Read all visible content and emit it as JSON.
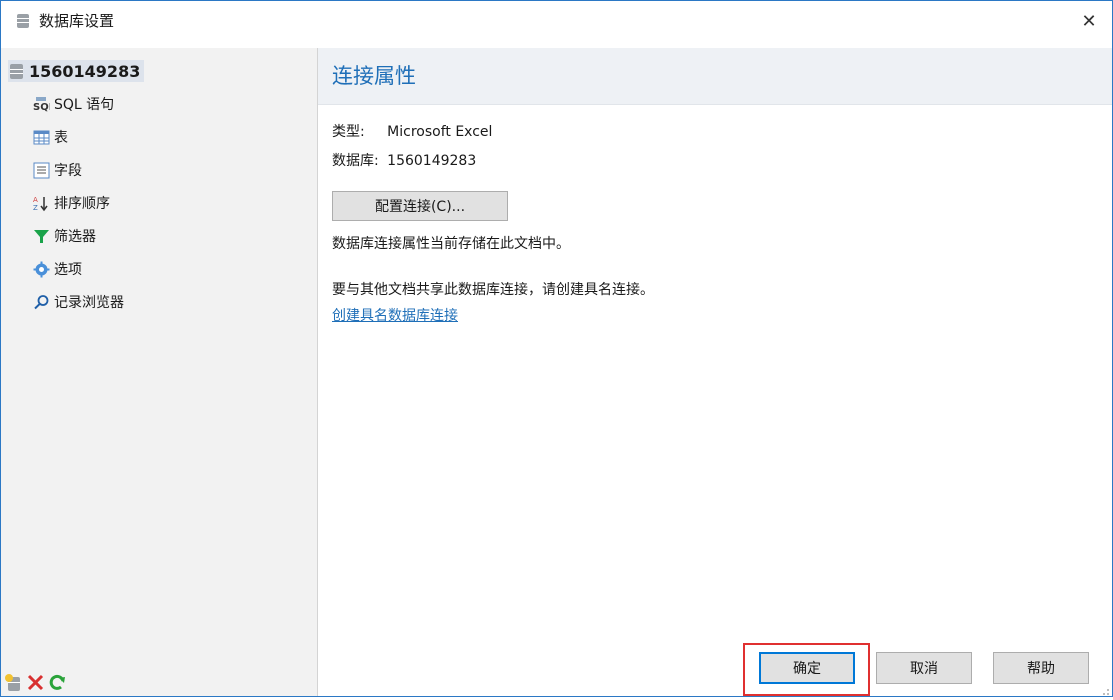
{
  "window": {
    "title": "数据库设置",
    "close_glyph": "✕"
  },
  "sidebar": {
    "root": {
      "label": "1560149283",
      "icon": "database-icon"
    },
    "items": [
      {
        "label": "SQL 语句",
        "icon": "sql-icon",
        "name": "sidebar-item-sql"
      },
      {
        "label": "表",
        "icon": "table-icon",
        "name": "sidebar-item-table"
      },
      {
        "label": "字段",
        "icon": "fields-icon",
        "name": "sidebar-item-fields"
      },
      {
        "label": "排序顺序",
        "icon": "sort-icon",
        "name": "sidebar-item-sort"
      },
      {
        "label": "筛选器",
        "icon": "filter-icon",
        "name": "sidebar-item-filter"
      },
      {
        "label": "选项",
        "icon": "gear-icon",
        "name": "sidebar-item-options"
      },
      {
        "label": "记录浏览器",
        "icon": "search-icon",
        "name": "sidebar-item-record-browser"
      }
    ],
    "bottom_buttons": [
      "add-database-icon",
      "delete-icon",
      "refresh-icon"
    ]
  },
  "content": {
    "header": "连接属性",
    "type_label": "类型:",
    "type_value": "Microsoft Excel",
    "db_label": "数据库:",
    "db_value": "1560149283",
    "config_button": "配置连接(C)...",
    "info_text": "数据库连接属性当前存储在此文档中。",
    "share_text": "要与其他文档共享此数据库连接，请创建具名连接。",
    "link_text": "创建具名数据库连接"
  },
  "footer": {
    "ok": "确定",
    "cancel": "取消",
    "help": "帮助"
  },
  "colors": {
    "accent": "#1f6fb8",
    "highlight": "#e03030",
    "window_border": "#2b78c5"
  }
}
